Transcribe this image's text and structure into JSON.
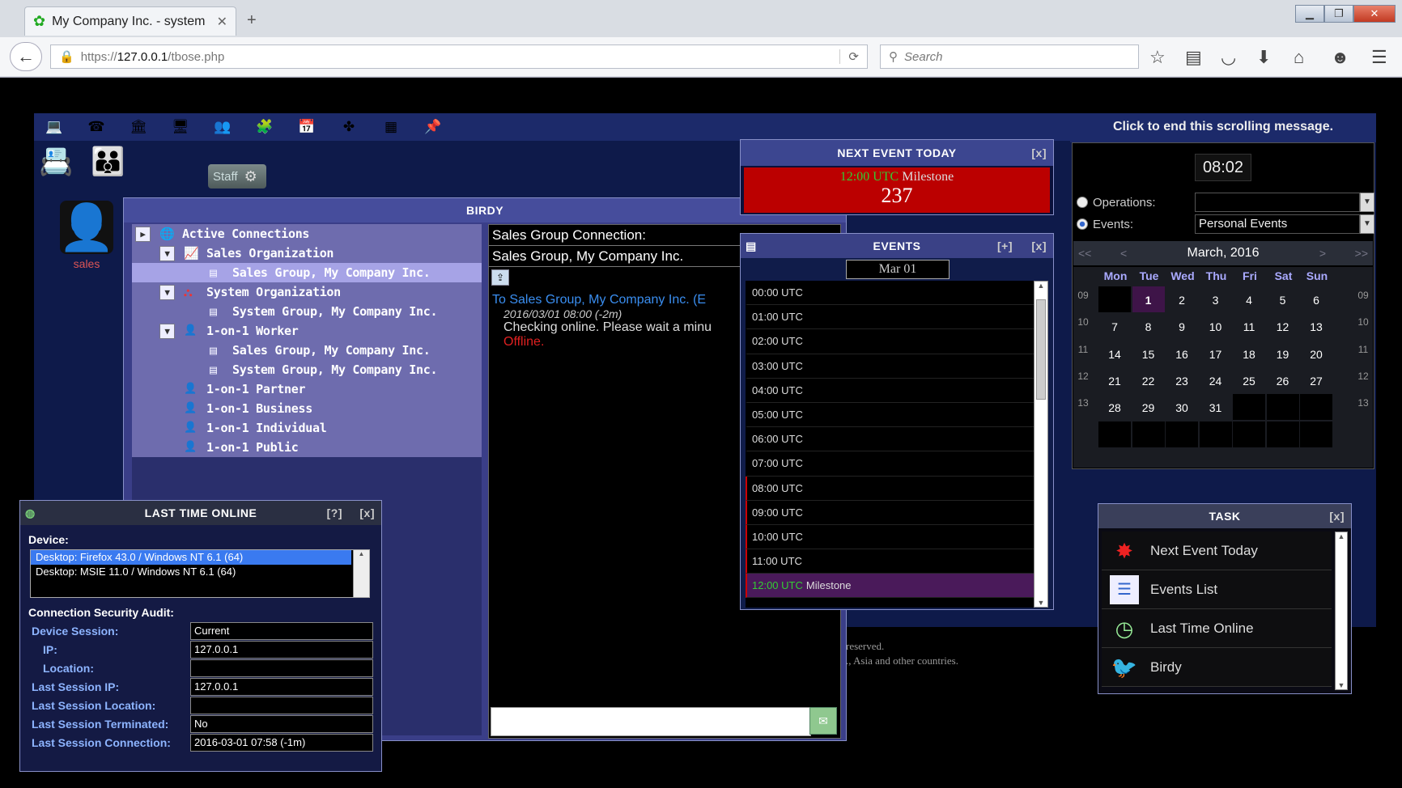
{
  "browser": {
    "tab_title": "My Company Inc. - system",
    "url_prefix": "https://",
    "url_host": "127.0.0.1",
    "url_path": "/tbose.php",
    "search_placeholder": "Search"
  },
  "app": {
    "staff_label": "Staff",
    "user_label": "sales",
    "scrolling_message": "Click to end this scrolling message.",
    "clock": "08:02",
    "background_text": [
      "reserved.",
      "., Asia and other countries."
    ]
  },
  "birdy": {
    "title": "BIRDY",
    "tree": [
      {
        "label": "Active Connections",
        "level": 0,
        "toggle": "right",
        "icon": "globe-icon"
      },
      {
        "label": "Sales Organization",
        "level": 1,
        "toggle": "down",
        "icon": "chart-icon"
      },
      {
        "label": "Sales Group, My Company Inc.",
        "level": 2,
        "icon": "document-icon",
        "selected": true
      },
      {
        "label": "System Organization",
        "level": 1,
        "toggle": "down",
        "icon": "org-icon"
      },
      {
        "label": "System Group, My Company Inc.",
        "level": 2,
        "icon": "document-icon"
      },
      {
        "label": "1-on-1 Worker",
        "level": 1,
        "toggle": "down",
        "icon": "person-icon"
      },
      {
        "label": "Sales Group, My Company Inc.",
        "level": 2,
        "icon": "document-icon"
      },
      {
        "label": "System Group, My Company Inc.",
        "level": 2,
        "icon": "document-icon"
      },
      {
        "label": "1-on-1 Partner",
        "level": 1,
        "icon": "person-icon"
      },
      {
        "label": "1-on-1 Business",
        "level": 1,
        "icon": "person-icon"
      },
      {
        "label": "1-on-1 Individual",
        "level": 1,
        "icon": "person-icon"
      },
      {
        "label": "1-on-1 Public",
        "level": 1,
        "icon": "person-icon"
      }
    ],
    "chat_header": "Sales Group Connection:",
    "chat_group": "Sales Group, My Company Inc.",
    "chat_to": "To Sales Group, My Company Inc. (E",
    "chat_time": "2016/03/01 08:00 (-2m)",
    "chat_msg": "Checking online. Please wait a minu",
    "chat_status": "Offline."
  },
  "next_event": {
    "title": "NEXT EVENT TODAY",
    "close": "[x]",
    "time": "12:00 UTC",
    "name": "Milestone",
    "countdown": "237"
  },
  "events": {
    "title": "EVENTS",
    "add": "[+]",
    "close": "[x]",
    "date": "Mar 01",
    "rows": [
      {
        "time": "00:00 UTC",
        "label": ""
      },
      {
        "time": "01:00 UTC",
        "label": ""
      },
      {
        "time": "02:00 UTC",
        "label": ""
      },
      {
        "time": "03:00 UTC",
        "label": ""
      },
      {
        "time": "04:00 UTC",
        "label": ""
      },
      {
        "time": "05:00 UTC",
        "label": ""
      },
      {
        "time": "06:00 UTC",
        "label": ""
      },
      {
        "time": "07:00 UTC",
        "label": ""
      },
      {
        "time": "08:00 UTC",
        "label": ""
      },
      {
        "time": "09:00 UTC",
        "label": ""
      },
      {
        "time": "10:00 UTC",
        "label": ""
      },
      {
        "time": "11:00 UTC",
        "label": ""
      },
      {
        "time": "12:00 UTC",
        "label": "Milestone"
      }
    ]
  },
  "options": {
    "operations_label": "Operations:",
    "operations_value": "",
    "events_label": "Events:",
    "events_value": "Personal Events"
  },
  "calendar": {
    "month": "March, 2016",
    "nav": [
      "<<",
      "<",
      ">",
      ">>"
    ],
    "days": [
      "Mon",
      "Tue",
      "Wed",
      "Thu",
      "Fri",
      "Sat",
      "Sun"
    ],
    "weeks": [
      {
        "wk": "09",
        "dates": [
          "",
          "1",
          "2",
          "3",
          "4",
          "5",
          "6"
        ]
      },
      {
        "wk": "10",
        "dates": [
          "7",
          "8",
          "9",
          "10",
          "11",
          "12",
          "13"
        ]
      },
      {
        "wk": "11",
        "dates": [
          "14",
          "15",
          "16",
          "17",
          "18",
          "19",
          "20"
        ]
      },
      {
        "wk": "12",
        "dates": [
          "21",
          "22",
          "23",
          "24",
          "25",
          "26",
          "27"
        ]
      },
      {
        "wk": "13",
        "dates": [
          "28",
          "29",
          "30",
          "31",
          "",
          "",
          ""
        ]
      },
      {
        "wk": "",
        "dates": [
          "",
          "",
          "",
          "",
          "",
          "",
          ""
        ]
      }
    ],
    "today": "1"
  },
  "task": {
    "title": "TASK",
    "close": "[x]",
    "items": [
      {
        "label": "Next Event Today",
        "icon": "alert-icon"
      },
      {
        "label": "Events List",
        "icon": "list-icon"
      },
      {
        "label": "Last Time Online",
        "icon": "clock-icon"
      },
      {
        "label": "Birdy",
        "icon": "bird-icon"
      }
    ]
  },
  "lto": {
    "title": "LAST TIME ONLINE",
    "help": "[?]",
    "close": "[x]",
    "device_label": "Device:",
    "devices": [
      "Desktop: Firefox 43.0 / Windows NT 6.1 (64)",
      "Desktop: MSIE 11.0 / Windows NT 6.1 (64)"
    ],
    "audit_label": "Connection Security Audit:",
    "audit": [
      {
        "key": "Device Session:",
        "value": "Current",
        "indent": false
      },
      {
        "key": "IP:",
        "value": "127.0.0.1",
        "indent": true
      },
      {
        "key": "Location:",
        "value": "",
        "indent": true
      },
      {
        "key": "Last Session IP:",
        "value": "127.0.0.1",
        "indent": false
      },
      {
        "key": "Last Session Location:",
        "value": "",
        "indent": false
      },
      {
        "key": "Last Session Terminated:",
        "value": "No",
        "indent": false
      },
      {
        "key": "Last Session Connection:",
        "value": "2016-03-01 07:58 (-1m)",
        "indent": false
      }
    ]
  },
  "colors": {
    "app_bg": "#0e1a4a",
    "panel_header": "#464d9c",
    "tree_row": "#6e6cae",
    "tree_selected": "#a6a3e6",
    "alert_red": "#b00000",
    "milestone_green": "#33cc33",
    "link_blue": "#3a8ef0",
    "offline_red": "#e02020"
  }
}
